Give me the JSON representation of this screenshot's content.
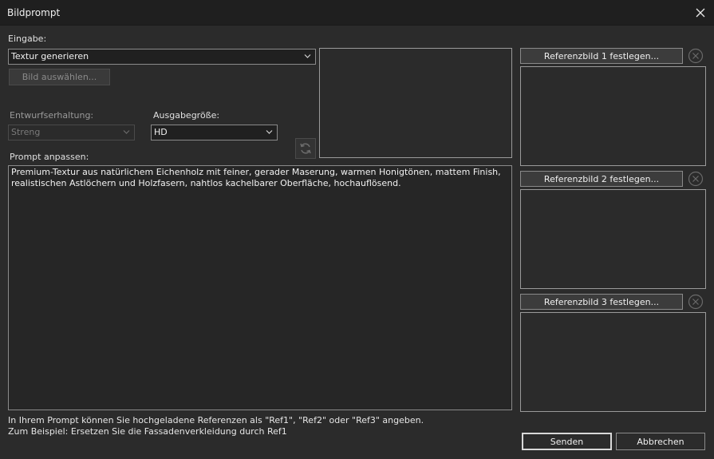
{
  "window": {
    "title": "Bildprompt"
  },
  "input": {
    "label": "Eingabe:",
    "mode_value": "Textur generieren",
    "select_image_label": "Bild auswählen..."
  },
  "design_preservation": {
    "label": "Entwurfserhaltung:",
    "value": "Streng"
  },
  "output_size": {
    "label": "Ausgabegröße:",
    "value": "HD"
  },
  "prompt": {
    "label": "Prompt anpassen:",
    "text": "Premium-Textur aus natürlichem Eichenholz mit feiner, gerader Maserung, warmen Honigtönen, mattem Finish,\nrealistischen Astlöchern und Holzfasern, nahtlos kachelbarer Oberfläche, hochauflösend."
  },
  "references": [
    {
      "button_label": "Referenzbild 1 festlegen..."
    },
    {
      "button_label": "Referenzbild 2 festlegen..."
    },
    {
      "button_label": "Referenzbild 3 festlegen..."
    }
  ],
  "hint": {
    "line1": "In Ihrem Prompt können Sie hochgeladene Referenzen als \"Ref1\", \"Ref2\" oder \"Ref3\" angeben.",
    "line2": "Zum Beispiel: Ersetzen Sie die Fassadenverkleidung durch Ref1"
  },
  "actions": {
    "send_label": "Senden",
    "cancel_label": "Abbrechen"
  },
  "icons": {
    "close": "close-icon",
    "chevron": "chevron-down-icon",
    "refresh": "refresh-icon",
    "clear": "clear-circle-x-icon"
  },
  "colors": {
    "background": "#2b2b2b",
    "titlebar": "#1f1f1f",
    "border": "#8a8a8a"
  }
}
